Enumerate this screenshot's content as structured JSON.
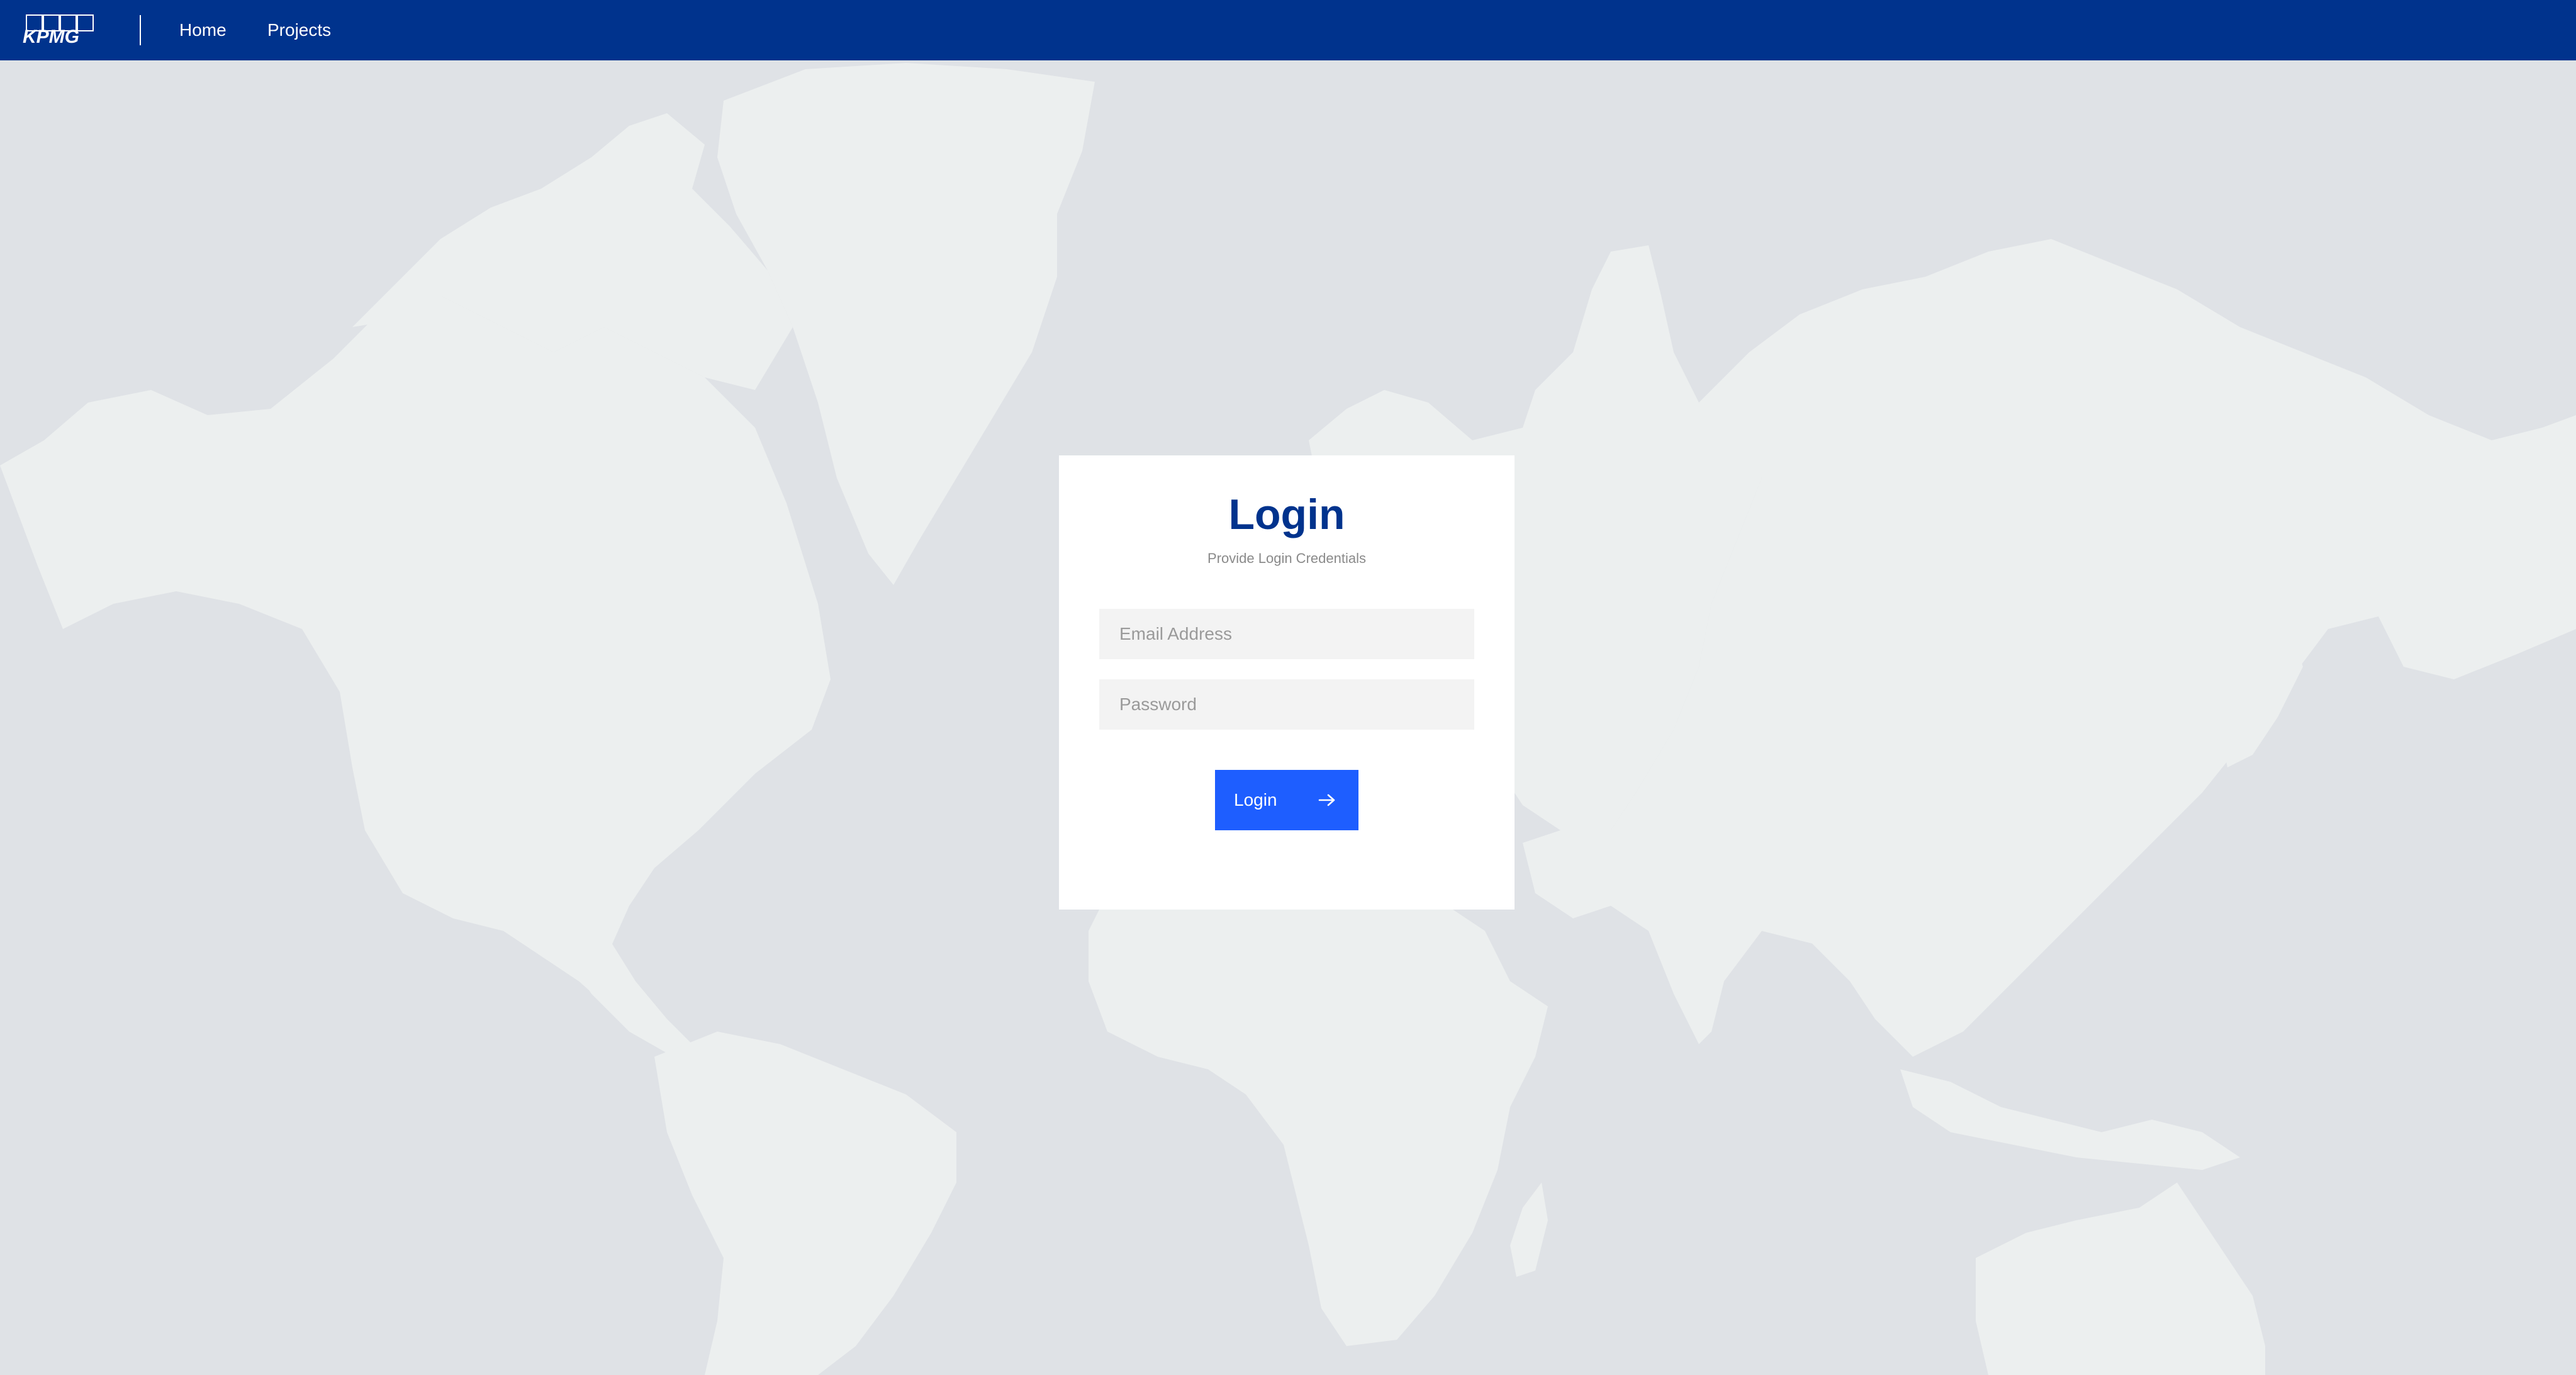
{
  "header": {
    "logo_text": "KPMG",
    "nav": [
      {
        "label": "Home"
      },
      {
        "label": "Projects"
      }
    ]
  },
  "login": {
    "title": "Login",
    "subtitle": "Provide Login Credentials",
    "email_placeholder": "Email Address",
    "password_placeholder": "Password",
    "button_label": "Login",
    "button_icon": "arrow-right-icon"
  },
  "colors": {
    "brand_blue": "#00338d",
    "button_blue": "#1e5eff",
    "background": "#dfe2e6",
    "land": "#ecefef",
    "field_background": "#f3f3f3"
  }
}
